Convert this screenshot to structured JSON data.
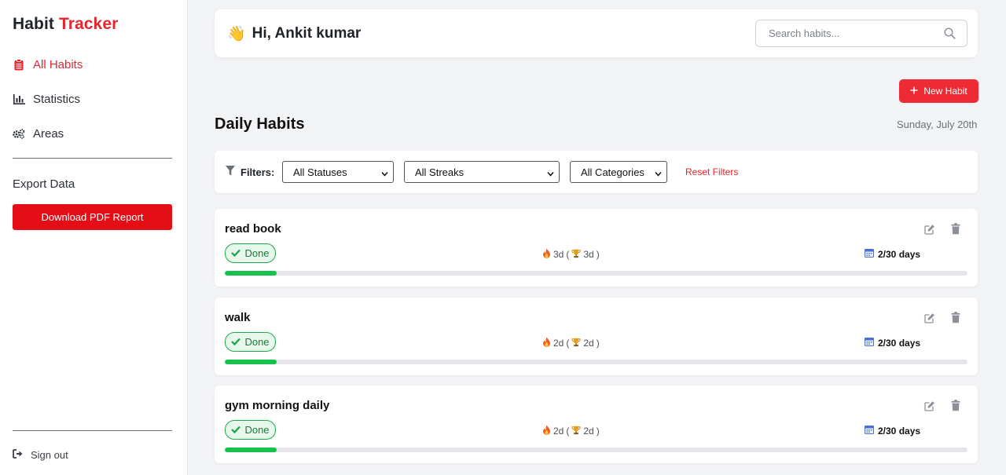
{
  "brand": {
    "part1": "Habit",
    "part2": "Tracker"
  },
  "nav": [
    {
      "label": "All Habits",
      "icon": "clipboard-icon",
      "active": true
    },
    {
      "label": "Statistics",
      "icon": "bar-chart-icon",
      "active": false
    },
    {
      "label": "Areas",
      "icon": "cogs-icon",
      "active": false
    }
  ],
  "export": {
    "label": "Export Data",
    "button": "Download PDF Report"
  },
  "signout": {
    "label": "Sign out"
  },
  "header": {
    "greeting": "Hi, Ankit kumar",
    "wave_icon": "👋"
  },
  "search": {
    "placeholder": "Search habits..."
  },
  "new_habit": {
    "label": "New Habit"
  },
  "section": {
    "title": "Daily Habits",
    "date": "Sunday, July 20th"
  },
  "filters": {
    "label": "Filters:",
    "status": "All Statuses",
    "streak": "All Streaks",
    "category": "All Categories",
    "reset": "Reset Filters"
  },
  "habits": [
    {
      "name": "read book",
      "status": "Done",
      "current": "3d",
      "best": "3d",
      "days": "2/30 days",
      "progress": 0.07
    },
    {
      "name": "walk",
      "status": "Done",
      "current": "2d",
      "best": "2d",
      "days": "2/30 days",
      "progress": 0.07
    },
    {
      "name": "gym morning daily",
      "status": "Done",
      "current": "2d",
      "best": "2d",
      "days": "2/30 days",
      "progress": 0.07
    }
  ],
  "colors": {
    "accent": "#e4262e",
    "pdf_button": "#e30e16",
    "success": "#16c24d"
  }
}
